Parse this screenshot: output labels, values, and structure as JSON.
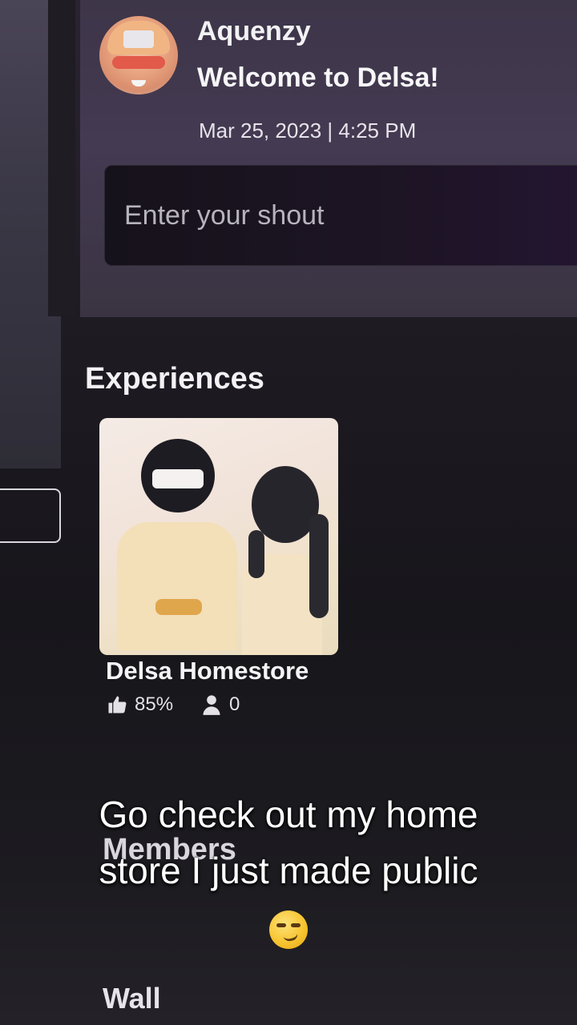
{
  "shout": {
    "username": "Aquenzy",
    "message": "Welcome to Delsa!",
    "timestamp": "Mar 25, 2023 | 4:25 PM",
    "input_placeholder": "Enter your shout"
  },
  "experiences": {
    "title": "Experiences",
    "items": [
      {
        "name": "Delsa Homestore",
        "rating": "85%",
        "players": "0"
      }
    ]
  },
  "sections": {
    "members": "Members",
    "wall": "Wall"
  },
  "caption": {
    "line1": "Go check out my home",
    "line2": "store I just made public",
    "emoji": "smirking-face-emoji"
  },
  "icons": {
    "rating": "thumbs-up-icon",
    "players": "player-icon"
  }
}
